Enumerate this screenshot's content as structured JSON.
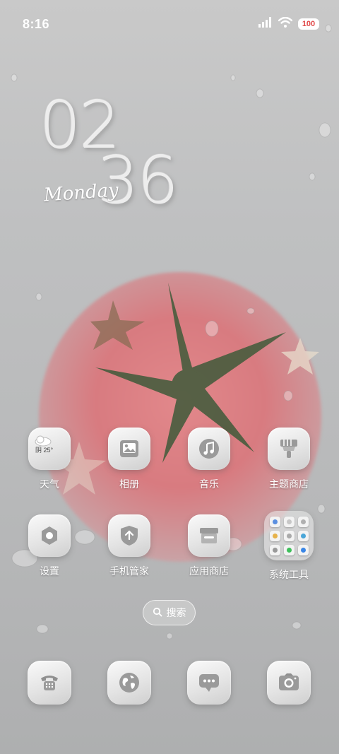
{
  "status_bar": {
    "time": "8:16",
    "battery": "100",
    "icons": [
      "signal-icon",
      "wifi-icon",
      "battery-icon"
    ]
  },
  "clock": {
    "hours": "02",
    "minutes": "36",
    "weekday": "Monday"
  },
  "apps_row1": [
    {
      "label": "天气",
      "icon": "weather-icon",
      "weather_text": "阴 25°"
    },
    {
      "label": "相册",
      "icon": "gallery-icon"
    },
    {
      "label": "音乐",
      "icon": "music-icon"
    },
    {
      "label": "主题商店",
      "icon": "theme-store-icon"
    }
  ],
  "apps_row2": [
    {
      "label": "设置",
      "icon": "settings-icon"
    },
    {
      "label": "手机管家",
      "icon": "phone-manager-icon"
    },
    {
      "label": "应用商店",
      "icon": "app-store-icon"
    },
    {
      "label": "系统工具",
      "icon": "folder-icon"
    }
  ],
  "search": {
    "label": "搜索",
    "icon": "search-icon"
  },
  "dock": [
    {
      "icon": "phone-icon"
    },
    {
      "icon": "browser-icon"
    },
    {
      "icon": "messages-icon"
    },
    {
      "icon": "camera-icon"
    }
  ],
  "colors": {
    "battery_text": "#e14a4a",
    "wallpaper_tomato": "#d87b80"
  }
}
